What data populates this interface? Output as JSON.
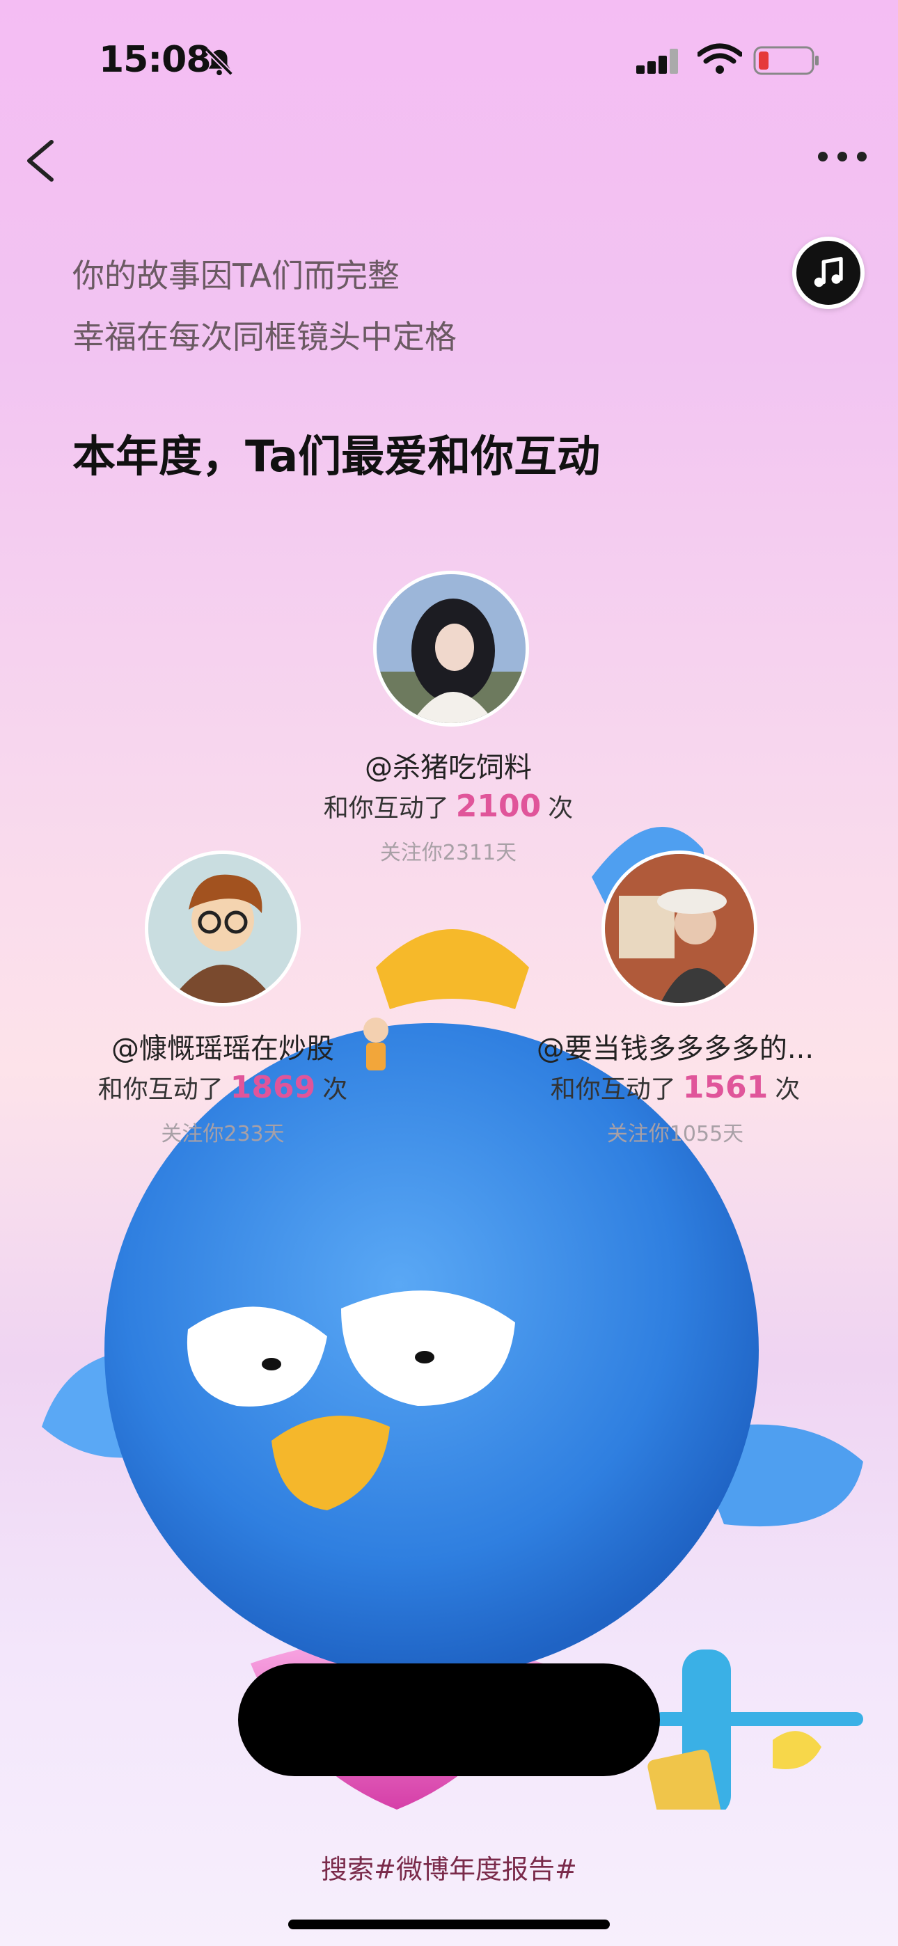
{
  "status_bar": {
    "time": "15:08"
  },
  "intro": {
    "line1": "你的故事因TA们而完整",
    "line2": "幸福在每次同框镜头中定格",
    "headline": "本年度，Ta们最爱和你互动"
  },
  "stat_prefix": "和你互动了",
  "stat_suffix": "次",
  "users": [
    {
      "name": "@杀猪吃饲料",
      "count": "2100",
      "since": "关注你2311天"
    },
    {
      "name": "@慷慨瑶瑶在炒股",
      "count": "1869",
      "since": "关注你233天"
    },
    {
      "name": "@要当钱多多多多的...",
      "count": "1561",
      "since": "关注你1055天"
    }
  ],
  "footer": {
    "search": "搜索#微博年度报告#"
  },
  "colors": {
    "accent": "#e0559a",
    "bird": "#3d8de6"
  },
  "icons": [
    "back-icon",
    "more-icon",
    "music-icon",
    "bell-slash-icon",
    "signal-icon",
    "wifi-icon",
    "battery-icon"
  ]
}
